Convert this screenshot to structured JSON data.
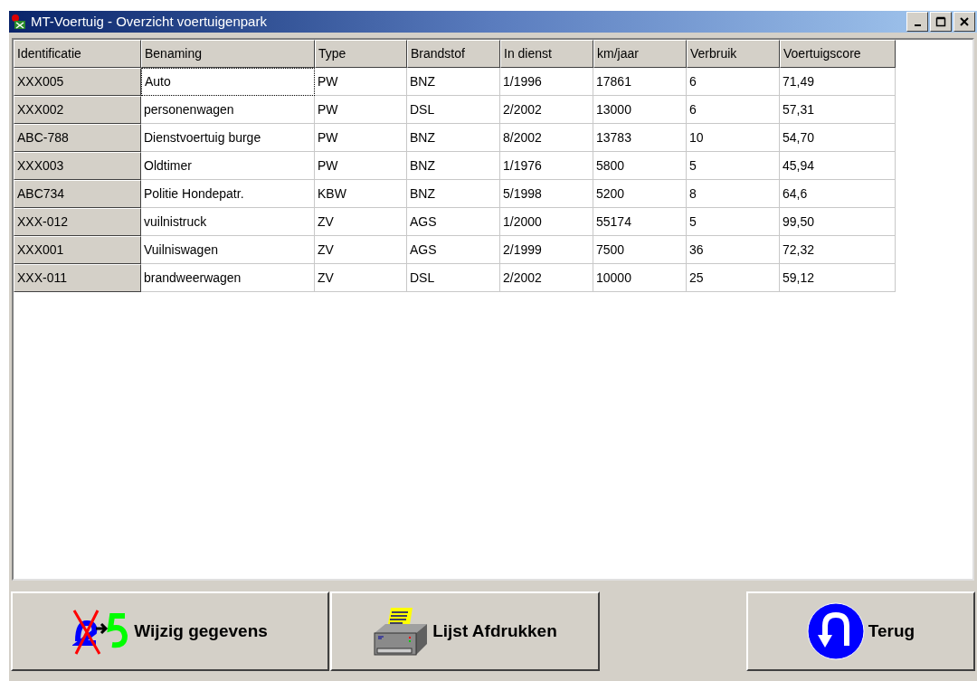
{
  "window": {
    "title": "MT-Voertuig - Overzicht voertuigenpark"
  },
  "table": {
    "columns": [
      "Identificatie",
      "Benaming",
      "Type",
      "Brandstof",
      "In dienst",
      "km/jaar",
      "Verbruik",
      "Voertuigscore"
    ],
    "rows": [
      {
        "cells": [
          "XXX005",
          "Auto",
          "PW",
          "BNZ",
          "1/1996",
          "17861",
          "6",
          "71,49"
        ],
        "focused": true
      },
      {
        "cells": [
          "XXX002",
          "personenwagen",
          "PW",
          "DSL",
          "2/2002",
          "13000",
          "6",
          "57,31"
        ],
        "focused": false
      },
      {
        "cells": [
          "ABC-788",
          "Dienstvoertuig burge",
          "PW",
          "BNZ",
          "8/2002",
          "13783",
          "10",
          "54,70"
        ],
        "focused": false
      },
      {
        "cells": [
          "XXX003",
          "Oldtimer",
          "PW",
          "BNZ",
          "1/1976",
          "5800",
          "5",
          "45,94"
        ],
        "focused": false
      },
      {
        "cells": [
          "ABC734",
          "Politie Hondepatr.",
          "KBW",
          "BNZ",
          "5/1998",
          "5200",
          "8",
          "64,6"
        ],
        "focused": false
      },
      {
        "cells": [
          "XXX-012",
          "vuilnistruck",
          "ZV",
          "AGS",
          "1/2000",
          "55174",
          "5",
          "99,50"
        ],
        "focused": false
      },
      {
        "cells": [
          "XXX001",
          "Vuilniswagen",
          "ZV",
          "AGS",
          "2/1999",
          "7500",
          "36",
          "72,32"
        ],
        "focused": false
      },
      {
        "cells": [
          "XXX-011",
          "brandweerwagen",
          "ZV",
          "DSL",
          "2/2002",
          "10000",
          "25",
          "59,12"
        ],
        "focused": false
      }
    ]
  },
  "buttons": [
    {
      "kind": "edit",
      "label": "Wijzig gegevens"
    },
    {
      "kind": "print",
      "label": "Lijst Afdrukken"
    },
    {
      "kind": "back",
      "label": "Terug"
    }
  ]
}
